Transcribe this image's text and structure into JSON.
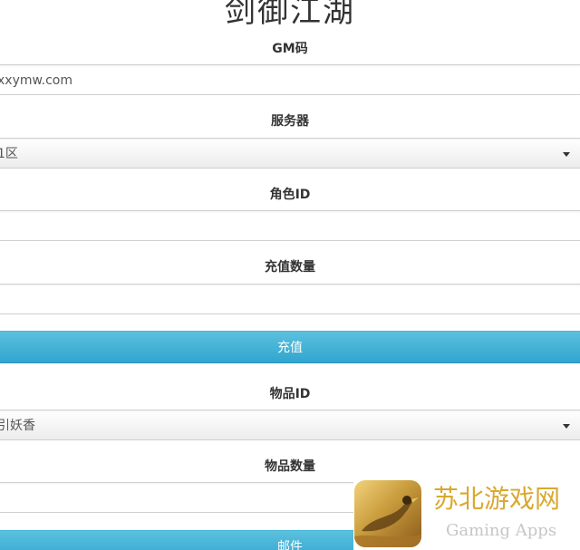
{
  "title": "剑御江湖",
  "gm_code": {
    "label": "GM码",
    "value": "xxymw.com"
  },
  "server": {
    "label": "服务器",
    "selected": "1区"
  },
  "role_id": {
    "label": "角色ID",
    "value": ""
  },
  "recharge_amount": {
    "label": "充值数量",
    "value": ""
  },
  "recharge_button": "充值",
  "item_id": {
    "label": "物品ID",
    "selected": "引妖香"
  },
  "item_amount": {
    "label": "物品数量",
    "value": ""
  },
  "mail_button": "邮件",
  "watermark": {
    "title": "苏北游戏网",
    "subtitle": "Gaming Apps"
  },
  "colors": {
    "button": "#3fb1d6",
    "watermark_gold": "#d9a830"
  }
}
